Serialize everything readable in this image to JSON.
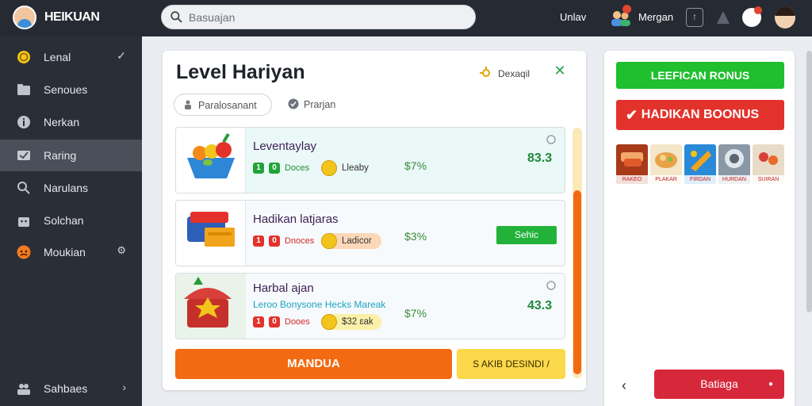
{
  "header": {
    "logo_text": "HEIKUAN",
    "search_placeholder": "Basuajan",
    "link": "Unlav",
    "user_name": "Mergan",
    "square_button": "↑"
  },
  "sidebar": {
    "items": [
      {
        "label": "Lenal",
        "icon": "coin-icon"
      },
      {
        "label": "Senoues",
        "icon": "folder-icon"
      },
      {
        "label": "Nerkan",
        "icon": "info-icon"
      },
      {
        "label": "Raring",
        "icon": "mail-check-icon"
      },
      {
        "label": "Narulans",
        "icon": "search-icon"
      },
      {
        "label": "Solchan",
        "icon": "bag-icon"
      },
      {
        "label": "Moukian",
        "icon": "angry-face-icon"
      }
    ],
    "footer": {
      "label": "Sahbaes",
      "icon": "users-icon"
    }
  },
  "main": {
    "title": "Level Hariyan",
    "header_action": "Dexaqil",
    "chips": [
      "Paralosanant",
      "Prarjan"
    ],
    "rows": [
      {
        "title": "Leventaylay",
        "subtitle": "",
        "badge_text": "Doces",
        "coin_label": "Lleaby",
        "percent": "$7%",
        "score": "83.3",
        "button": ""
      },
      {
        "title": "Hadikan latjaras",
        "subtitle": "",
        "badge_text": "Dnoces",
        "coin_label": "Ladicor",
        "percent": "$3%",
        "score": "",
        "button": "Sehic"
      },
      {
        "title": "Harbal ajan",
        "subtitle": "Leroo Bonysone Hecks Mareak",
        "badge_text": "Dooes",
        "coin_label": "$32 ɛak",
        "percent": "$7%",
        "score": "43.3",
        "button": ""
      }
    ],
    "primary_button": "MANDUA",
    "secondary_button": "S AKIB DESINDI /"
  },
  "right_panel": {
    "green_button": "LEEFICAN RONUS",
    "red_button": "HADIKAN BOONUS",
    "thumb_labels": [
      "RAKEO",
      "PLAKAR",
      "FIRDAN",
      "HURDAN",
      "SUIRAN"
    ],
    "bottom_button": "Batiaga"
  },
  "colors": {
    "topbar": "#262a33",
    "sidebar": "#2a2e37",
    "accent_orange": "#f26a12",
    "accent_green": "#1fbf2e",
    "accent_red": "#e3322b",
    "accent_yellow": "#fbd94a"
  }
}
